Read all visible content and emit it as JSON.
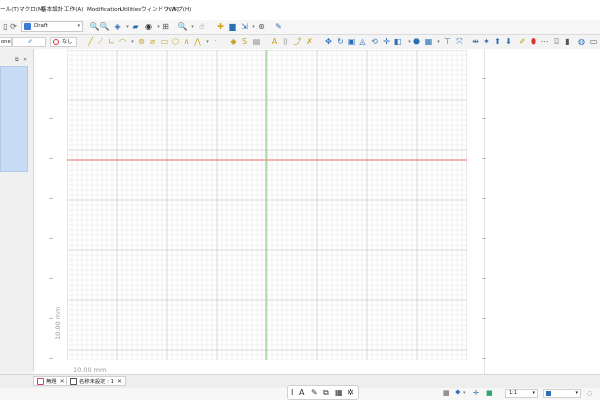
{
  "menubar": {
    "items": [
      "ール(T)",
      "マクロ(M)",
      "基本設計",
      "工作(A)",
      "Modification",
      "Utilities",
      "ウィンドウ(W)",
      "ヘルプ(H)"
    ]
  },
  "toolbar": {
    "workbench": "Draft"
  },
  "options_row": {
    "left_value": "one",
    "snap_label": "なし"
  },
  "canvas": {
    "dim_horizontal": "10.00 mm",
    "dim_vertical": "10.00 mm",
    "colors": {
      "grid_minor": "#e3e3e3",
      "grid_major": "#cccccc",
      "axis_x": "#e56b6b",
      "axis_y": "#7fd77f"
    }
  },
  "tabs": [
    {
      "label": "無題",
      "icon": "freecad-icon"
    },
    {
      "label": "名称未設定 : 1",
      "icon": "document-icon"
    }
  ],
  "statusbar": {
    "scale": "1:1",
    "units": ""
  }
}
